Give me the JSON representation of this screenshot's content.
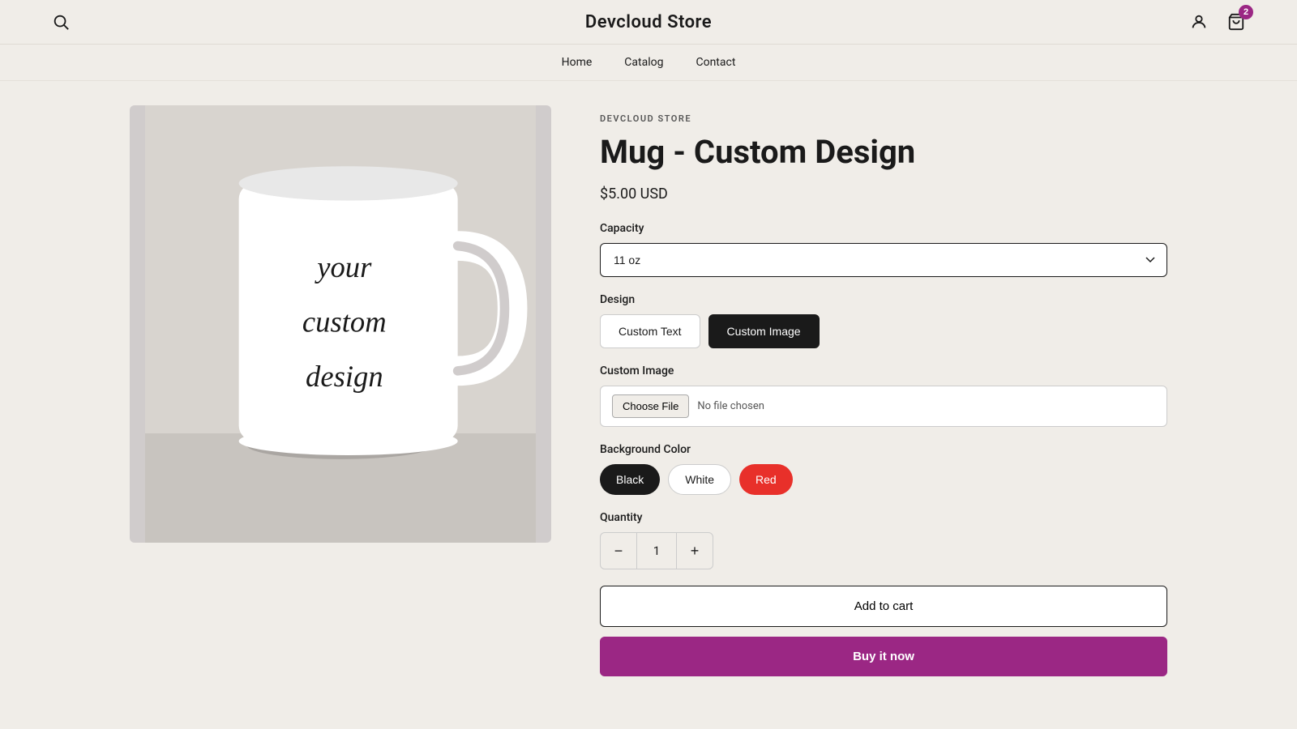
{
  "header": {
    "store_name": "Devcloud Store",
    "cart_count": "2"
  },
  "nav": {
    "items": [
      {
        "label": "Home",
        "id": "home"
      },
      {
        "label": "Catalog",
        "id": "catalog"
      },
      {
        "label": "Contact",
        "id": "contact"
      }
    ]
  },
  "product": {
    "brand": "DEVCLOUD STORE",
    "title": "Mug - Custom Design",
    "price": "$5.00 USD",
    "capacity_label": "Capacity",
    "capacity_value": "11 oz",
    "design_label": "Design",
    "design_options": [
      {
        "label": "Custom Text",
        "id": "custom-text",
        "active": false
      },
      {
        "label": "Custom Image",
        "id": "custom-image",
        "active": true
      }
    ],
    "custom_image_label": "Custom Image",
    "file_btn_label": "Choose File",
    "file_placeholder": "No file chosen",
    "bg_color_label": "Background Color",
    "colors": [
      {
        "label": "Black",
        "id": "black",
        "active": true
      },
      {
        "label": "White",
        "id": "white",
        "active": false
      },
      {
        "label": "Red",
        "id": "red",
        "active": false
      }
    ],
    "quantity_label": "Quantity",
    "quantity_value": "1",
    "add_to_cart_label": "Add to cart",
    "buy_now_label": "Buy it now"
  }
}
